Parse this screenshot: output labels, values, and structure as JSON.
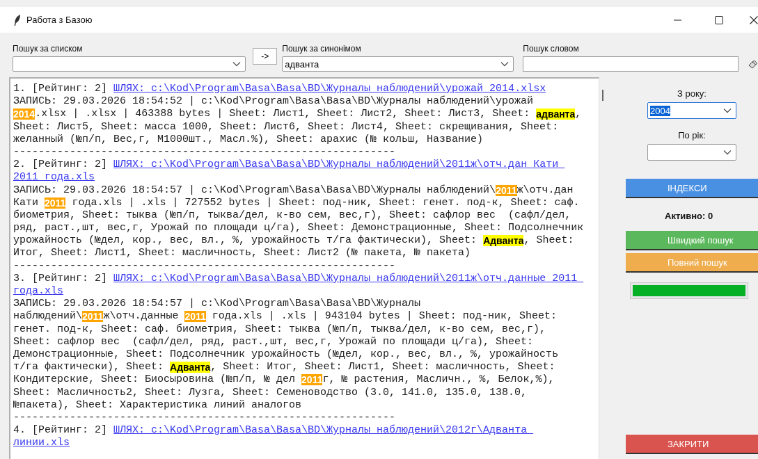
{
  "window": {
    "title": "Работа з Базою"
  },
  "toolbar": {
    "list_search": {
      "label": "Пошук за списком"
    },
    "arrow_button": "->",
    "synonym_search": {
      "label": "Пошук за синонімом",
      "value": "адванта"
    },
    "word_search": {
      "label": "Пошук словом"
    }
  },
  "results": {
    "lines": [
      [
        {
          "kind": "plain",
          "text": "1. [Рейтинг: 2] "
        },
        {
          "kind": "link",
          "text": "ШЛЯХ: c:\\Kod\\Program\\Basa\\Basa\\BD\\Журналы наблюдений\\урожай 2014.xlsx"
        }
      ],
      [
        {
          "kind": "plain",
          "text": "ЗАПИСЬ: 29.03.2026 18:54:52 | c:\\Kod\\Program\\Basa\\Basa\\BD\\Журналы наблюдений\\урожай"
        }
      ],
      [
        {
          "kind": "year",
          "text": "2014"
        },
        {
          "kind": "plain",
          "text": ".xlsx | .xlsx | 463388 bytes | Sheet: Лист1, Sheet: Лист2, Sheet: Лист3, Sheet: "
        },
        {
          "kind": "term",
          "text": "адванта"
        },
        {
          "kind": "plain",
          "text": ","
        }
      ],
      [
        {
          "kind": "plain",
          "text": "Sheet: Лист5, Sheet: масса 1000, Sheet: Лист6, Sheet: Лист4, Sheet: скрещивания, Sheet:"
        }
      ],
      [
        {
          "kind": "plain",
          "text": "желанный (№п/п, Вес,г, М1000шт., Масл.%), Sheet: арахис (№ кольш, Название)"
        }
      ],
      [
        {
          "kind": "rule",
          "text": "-------------------------------------------------------------"
        }
      ],
      [
        {
          "kind": "plain",
          "text": "2. [Рейтинг: 2] "
        },
        {
          "kind": "link",
          "text": "ШЛЯХ: c:\\Kod\\Program\\Basa\\Basa\\BD\\Журналы наблюдений\\2011ж\\отч.дан Кати "
        }
      ],
      [
        {
          "kind": "link",
          "text": "2011 года.xls"
        }
      ],
      [
        {
          "kind": "plain",
          "text": "ЗАПИСЬ: 29.03.2026 18:54:57 | c:\\Kod\\Program\\Basa\\Basa\\BD\\Журналы наблюдений\\"
        },
        {
          "kind": "year",
          "text": "2011"
        },
        {
          "kind": "plain",
          "text": "ж\\отч.дан"
        }
      ],
      [
        {
          "kind": "plain",
          "text": "Кати "
        },
        {
          "kind": "year",
          "text": "2011"
        },
        {
          "kind": "plain",
          "text": " года.xls | .xls | 727552 bytes | Sheet: под-ник, Sheet: генет. под-к, Sheet: саф."
        }
      ],
      [
        {
          "kind": "plain",
          "text": "биометрия, Sheet: тыква (№п/п, тыква/дел, к-во сем, вес,г), Sheet: сафлор вес  (сафл/дел,"
        }
      ],
      [
        {
          "kind": "plain",
          "text": "ряд, раст.,шт, вес,г, Урожай по площади ц/га), Sheet: Демонстрационные, Sheet: Подсолнечник"
        }
      ],
      [
        {
          "kind": "plain",
          "text": "урожайность (№дел, кор., вес, вл., %, урожайность т/га фактически), Sheet: "
        },
        {
          "kind": "term",
          "text": "Адванта"
        },
        {
          "kind": "plain",
          "text": ", Sheet:"
        }
      ],
      [
        {
          "kind": "plain",
          "text": "Итог, Sheet: Лист1, Sheet: масличность, Sheet: Лист2 (№ пакета, № пакета)"
        }
      ],
      [
        {
          "kind": "rule",
          "text": "-------------------------------------------------------------"
        }
      ],
      [
        {
          "kind": "plain",
          "text": "3. [Рейтинг: 2] "
        },
        {
          "kind": "link",
          "text": "ШЛЯХ: c:\\Kod\\Program\\Basa\\Basa\\BD\\Журналы наблюдений\\2011ж\\отч.данные 2011 "
        }
      ],
      [
        {
          "kind": "link",
          "text": "года.xls"
        }
      ],
      [
        {
          "kind": "plain",
          "text": "ЗАПИСЬ: 29.03.2026 18:54:57 | c:\\Kod\\Program\\Basa\\Basa\\BD\\Журналы"
        }
      ],
      [
        {
          "kind": "plain",
          "text": "наблюдений\\"
        },
        {
          "kind": "year",
          "text": "2011"
        },
        {
          "kind": "plain",
          "text": "ж\\отч.данные "
        },
        {
          "kind": "year",
          "text": "2011"
        },
        {
          "kind": "plain",
          "text": " года.xls | .xls | 943104 bytes | Sheet: под-ник, Sheet:"
        }
      ],
      [
        {
          "kind": "plain",
          "text": "генет. под-к, Sheet: саф. биометрия, Sheet: тыква (№п/п, тыква/дел, к-во сем, вес,г),"
        }
      ],
      [
        {
          "kind": "plain",
          "text": "Sheet: сафлор вес  (сафл/дел, ряд, раст.,шт, вес,г, Урожай по площади ц/га), Sheet:"
        }
      ],
      [
        {
          "kind": "plain",
          "text": "Демонстрационные, Sheet: Подсолнечник урожайность (№дел, кор., вес, вл., %, урожайность"
        }
      ],
      [
        {
          "kind": "plain",
          "text": "т/га фактически), Sheet: "
        },
        {
          "kind": "term",
          "text": "Адванта"
        },
        {
          "kind": "plain",
          "text": ", Sheet: Итог, Sheet: Лист1, Sheet: масличность, Sheet:"
        }
      ],
      [
        {
          "kind": "plain",
          "text": "Кондитерские, Sheet: Биосыровина (№п/п, № дел "
        },
        {
          "kind": "year",
          "text": "2011"
        },
        {
          "kind": "plain",
          "text": "г, № растения, Масличн., %, Белок,%),"
        }
      ],
      [
        {
          "kind": "plain",
          "text": "Sheet: Масличность2, Sheet: Лузга, Sheet: Семеноводство (3.0, 141.0, 135.0, 138.0,"
        }
      ],
      [
        {
          "kind": "plain",
          "text": "№пакета), Sheet: Характеристика линий аналогов"
        }
      ],
      [
        {
          "kind": "rule",
          "text": "-------------------------------------------------------------"
        }
      ],
      [
        {
          "kind": "plain",
          "text": "4. [Рейтинг: 2] "
        },
        {
          "kind": "link",
          "text": "ШЛЯХ: c:\\Kod\\Program\\Basa\\Basa\\BD\\Журналы наблюдений\\2012г\\Адванта "
        }
      ],
      [
        {
          "kind": "link",
          "text": "линии.xls"
        }
      ]
    ]
  },
  "side_panel": {
    "from_year": {
      "label": "З року:",
      "value": "2004",
      "focused": true
    },
    "to_year": {
      "label": "По рік:",
      "focused": false
    },
    "index_button": "ІНДЕКСИ",
    "active_count": "Активно: 0",
    "quick_search_button": "Швидкий пошук",
    "full_search_button": "Повний пошук",
    "progress": {
      "level": 1
    },
    "close_button": "ЗАКРИТИ"
  }
}
